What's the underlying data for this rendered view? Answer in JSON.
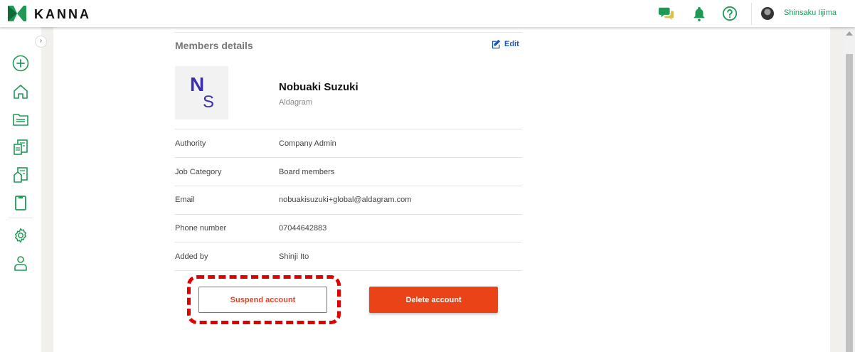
{
  "header": {
    "brand": "KANNA",
    "user_name": "Shinsaku Iijima",
    "icons": [
      "chat-icon",
      "bell-icon",
      "help-icon"
    ],
    "accent_color": "#1a9a5a"
  },
  "sidebar": {
    "collapse_glyph": "›",
    "items": [
      "add-icon",
      "home-icon",
      "folder-icon",
      "documents-icon",
      "buildings-icon",
      "clipboard-icon",
      "gear-icon",
      "person-icon"
    ]
  },
  "members": {
    "section_title": "Members details",
    "edit_label": "Edit",
    "initial_first": "N",
    "initial_second": "S",
    "name": "Nobuaki Suzuki",
    "company": "Aldagram",
    "rows": [
      {
        "label": "Authority",
        "value": "Company Admin"
      },
      {
        "label": "Job Category",
        "value": "Board members"
      },
      {
        "label": "Email",
        "value": "nobuakisuzuki+global@aldagram.com"
      },
      {
        "label": "Phone number",
        "value": "07044642883"
      },
      {
        "label": "Added by",
        "value": "Shinji Ito"
      }
    ]
  },
  "actions": {
    "suspend_label": "Suspend account",
    "delete_label": "Delete account",
    "danger_color": "#ea4317"
  }
}
